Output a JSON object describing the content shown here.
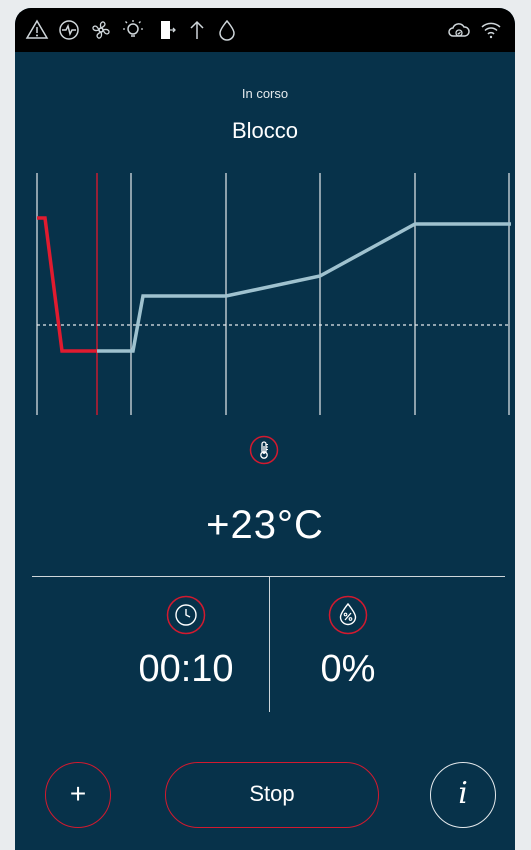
{
  "statusbar": {
    "icons": [
      "warning-icon",
      "pulse-icon",
      "fan-icon",
      "light-icon",
      "door-icon",
      "arrow-up-icon",
      "drop-icon",
      "cloud-icon",
      "wifi-icon"
    ]
  },
  "header": {
    "subtitle": "In corso",
    "title": "Blocco"
  },
  "chart_data": {
    "type": "line",
    "title": "",
    "xlabel": "",
    "ylabel": "",
    "series": [
      {
        "values_progress": "completed segment shown in red",
        "color": "#e01b2f"
      },
      {
        "values_remaining": "remaining segment shown in light blue",
        "color": "#9fc2cf"
      }
    ],
    "phases": 5
  },
  "temperature": {
    "value": "+23°C"
  },
  "timer": {
    "value": "00:10"
  },
  "humidity": {
    "value": "0%"
  },
  "controls": {
    "add_label": "+",
    "stop_label": "Stop",
    "info_label": "i"
  },
  "colors": {
    "background": "#07324a",
    "accent": "#d21a2f",
    "line": "#9fc2cf"
  }
}
